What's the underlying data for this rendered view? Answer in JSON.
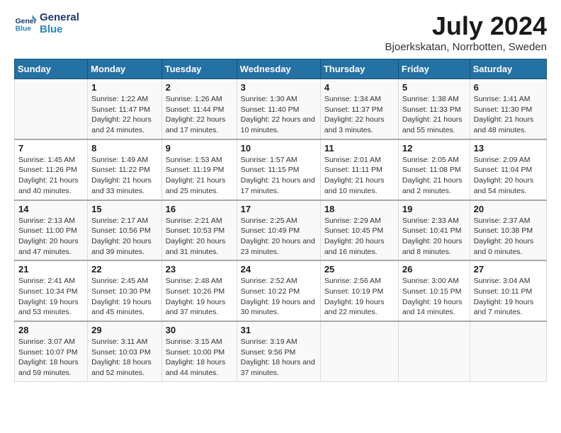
{
  "logo": {
    "text_general": "General",
    "text_blue": "Blue"
  },
  "title": "July 2024",
  "location": "Bjoerkskatan, Norrbotten, Sweden",
  "weekdays": [
    "Sunday",
    "Monday",
    "Tuesday",
    "Wednesday",
    "Thursday",
    "Friday",
    "Saturday"
  ],
  "weeks": [
    [
      {
        "day": "",
        "sunrise": "",
        "sunset": "",
        "daylight": ""
      },
      {
        "day": "1",
        "sunrise": "Sunrise: 1:22 AM",
        "sunset": "Sunset: 11:47 PM",
        "daylight": "Daylight: 22 hours and 24 minutes."
      },
      {
        "day": "2",
        "sunrise": "Sunrise: 1:26 AM",
        "sunset": "Sunset: 11:44 PM",
        "daylight": "Daylight: 22 hours and 17 minutes."
      },
      {
        "day": "3",
        "sunrise": "Sunrise: 1:30 AM",
        "sunset": "Sunset: 11:40 PM",
        "daylight": "Daylight: 22 hours and 10 minutes."
      },
      {
        "day": "4",
        "sunrise": "Sunrise: 1:34 AM",
        "sunset": "Sunset: 11:37 PM",
        "daylight": "Daylight: 22 hours and 3 minutes."
      },
      {
        "day": "5",
        "sunrise": "Sunrise: 1:38 AM",
        "sunset": "Sunset: 11:33 PM",
        "daylight": "Daylight: 21 hours and 55 minutes."
      },
      {
        "day": "6",
        "sunrise": "Sunrise: 1:41 AM",
        "sunset": "Sunset: 11:30 PM",
        "daylight": "Daylight: 21 hours and 48 minutes."
      }
    ],
    [
      {
        "day": "7",
        "sunrise": "Sunrise: 1:45 AM",
        "sunset": "Sunset: 11:26 PM",
        "daylight": "Daylight: 21 hours and 40 minutes."
      },
      {
        "day": "8",
        "sunrise": "Sunrise: 1:49 AM",
        "sunset": "Sunset: 11:22 PM",
        "daylight": "Daylight: 21 hours and 33 minutes."
      },
      {
        "day": "9",
        "sunrise": "Sunrise: 1:53 AM",
        "sunset": "Sunset: 11:19 PM",
        "daylight": "Daylight: 21 hours and 25 minutes."
      },
      {
        "day": "10",
        "sunrise": "Sunrise: 1:57 AM",
        "sunset": "Sunset: 11:15 PM",
        "daylight": "Daylight: 21 hours and 17 minutes."
      },
      {
        "day": "11",
        "sunrise": "Sunrise: 2:01 AM",
        "sunset": "Sunset: 11:11 PM",
        "daylight": "Daylight: 21 hours and 10 minutes."
      },
      {
        "day": "12",
        "sunrise": "Sunrise: 2:05 AM",
        "sunset": "Sunset: 11:08 PM",
        "daylight": "Daylight: 21 hours and 2 minutes."
      },
      {
        "day": "13",
        "sunrise": "Sunrise: 2:09 AM",
        "sunset": "Sunset: 11:04 PM",
        "daylight": "Daylight: 20 hours and 54 minutes."
      }
    ],
    [
      {
        "day": "14",
        "sunrise": "Sunrise: 2:13 AM",
        "sunset": "Sunset: 11:00 PM",
        "daylight": "Daylight: 20 hours and 47 minutes."
      },
      {
        "day": "15",
        "sunrise": "Sunrise: 2:17 AM",
        "sunset": "Sunset: 10:56 PM",
        "daylight": "Daylight: 20 hours and 39 minutes."
      },
      {
        "day": "16",
        "sunrise": "Sunrise: 2:21 AM",
        "sunset": "Sunset: 10:53 PM",
        "daylight": "Daylight: 20 hours and 31 minutes."
      },
      {
        "day": "17",
        "sunrise": "Sunrise: 2:25 AM",
        "sunset": "Sunset: 10:49 PM",
        "daylight": "Daylight: 20 hours and 23 minutes."
      },
      {
        "day": "18",
        "sunrise": "Sunrise: 2:29 AM",
        "sunset": "Sunset: 10:45 PM",
        "daylight": "Daylight: 20 hours and 16 minutes."
      },
      {
        "day": "19",
        "sunrise": "Sunrise: 2:33 AM",
        "sunset": "Sunset: 10:41 PM",
        "daylight": "Daylight: 20 hours and 8 minutes."
      },
      {
        "day": "20",
        "sunrise": "Sunrise: 2:37 AM",
        "sunset": "Sunset: 10:38 PM",
        "daylight": "Daylight: 20 hours and 0 minutes."
      }
    ],
    [
      {
        "day": "21",
        "sunrise": "Sunrise: 2:41 AM",
        "sunset": "Sunset: 10:34 PM",
        "daylight": "Daylight: 19 hours and 53 minutes."
      },
      {
        "day": "22",
        "sunrise": "Sunrise: 2:45 AM",
        "sunset": "Sunset: 10:30 PM",
        "daylight": "Daylight: 19 hours and 45 minutes."
      },
      {
        "day": "23",
        "sunrise": "Sunrise: 2:48 AM",
        "sunset": "Sunset: 10:26 PM",
        "daylight": "Daylight: 19 hours and 37 minutes."
      },
      {
        "day": "24",
        "sunrise": "Sunrise: 2:52 AM",
        "sunset": "Sunset: 10:22 PM",
        "daylight": "Daylight: 19 hours and 30 minutes."
      },
      {
        "day": "25",
        "sunrise": "Sunrise: 2:56 AM",
        "sunset": "Sunset: 10:19 PM",
        "daylight": "Daylight: 19 hours and 22 minutes."
      },
      {
        "day": "26",
        "sunrise": "Sunrise: 3:00 AM",
        "sunset": "Sunset: 10:15 PM",
        "daylight": "Daylight: 19 hours and 14 minutes."
      },
      {
        "day": "27",
        "sunrise": "Sunrise: 3:04 AM",
        "sunset": "Sunset: 10:11 PM",
        "daylight": "Daylight: 19 hours and 7 minutes."
      }
    ],
    [
      {
        "day": "28",
        "sunrise": "Sunrise: 3:07 AM",
        "sunset": "Sunset: 10:07 PM",
        "daylight": "Daylight: 18 hours and 59 minutes."
      },
      {
        "day": "29",
        "sunrise": "Sunrise: 3:11 AM",
        "sunset": "Sunset: 10:03 PM",
        "daylight": "Daylight: 18 hours and 52 minutes."
      },
      {
        "day": "30",
        "sunrise": "Sunrise: 3:15 AM",
        "sunset": "Sunset: 10:00 PM",
        "daylight": "Daylight: 18 hours and 44 minutes."
      },
      {
        "day": "31",
        "sunrise": "Sunrise: 3:19 AM",
        "sunset": "Sunset: 9:56 PM",
        "daylight": "Daylight: 18 hours and 37 minutes."
      },
      {
        "day": "",
        "sunrise": "",
        "sunset": "",
        "daylight": ""
      },
      {
        "day": "",
        "sunrise": "",
        "sunset": "",
        "daylight": ""
      },
      {
        "day": "",
        "sunrise": "",
        "sunset": "",
        "daylight": ""
      }
    ]
  ]
}
